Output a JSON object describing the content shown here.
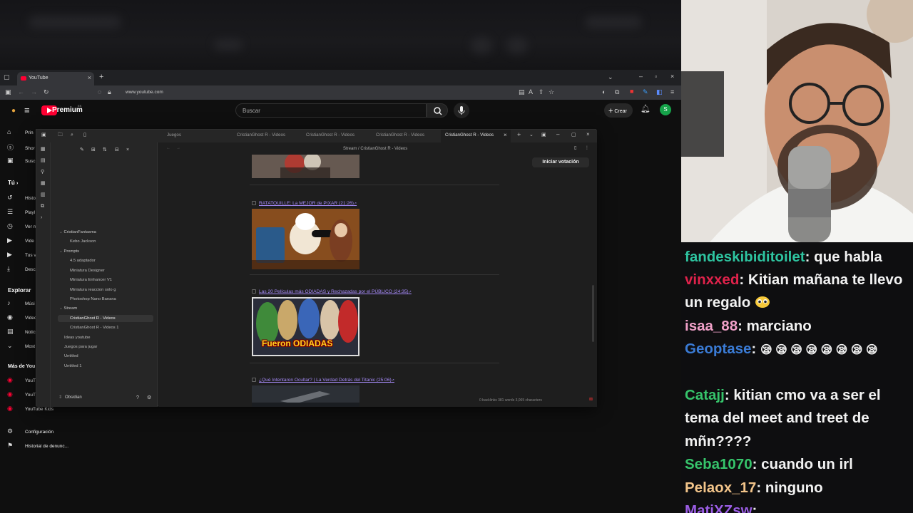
{
  "browser": {
    "tab_title": "YouTube",
    "url": "www.youtube.com"
  },
  "youtube": {
    "brand": "Premium",
    "brand_superscript": "ES",
    "search_placeholder": "Buscar",
    "create_label": "Crear",
    "avatar_letter": "S",
    "sidebar": {
      "items_top": [
        {
          "label": "Prin",
          "icon": "home-icon"
        },
        {
          "label": "Shor",
          "icon": "shorts-icon"
        },
        {
          "label": "Susc",
          "icon": "subscriptions-icon"
        }
      ],
      "you_header": "Tú",
      "items_you": [
        {
          "label": "Histo",
          "icon": "history-icon"
        },
        {
          "label": "Playl",
          "icon": "playlist-icon"
        },
        {
          "label": "Ver m",
          "icon": "watch-later-icon"
        },
        {
          "label": "Vide",
          "icon": "your-videos-icon"
        },
        {
          "label": "Tus v",
          "icon": "your-videos-icon"
        },
        {
          "label": "Desc",
          "icon": "download-icon"
        }
      ],
      "explore_header": "Explorar",
      "items_explore": [
        {
          "label": "Músi",
          "icon": "music-icon"
        },
        {
          "label": "Video",
          "icon": "gaming-icon"
        },
        {
          "label": "Notic",
          "icon": "news-icon"
        },
        {
          "label": "Most",
          "icon": "chevron-down-icon"
        }
      ],
      "more_header": "Más de You",
      "items_more": [
        {
          "label": "YouT",
          "icon": "youtube-studio-icon"
        },
        {
          "label": "YouT",
          "icon": "youtube-music-icon"
        },
        {
          "label": "YouTube Kids",
          "icon": "youtube-kids-icon"
        }
      ],
      "items_bottom": [
        {
          "label": "Configuración",
          "icon": "gear-icon"
        },
        {
          "label": "Historial de denunc...",
          "icon": "flag-icon"
        }
      ]
    }
  },
  "obsidian": {
    "tabs": [
      "Juegos",
      "CristianGhost R - Videos",
      "CristianGhost R - Videos",
      "CristianGhost R - Videos",
      "CristianGhost R - Videos"
    ],
    "breadcrumb": "Stream  /  CristianGhost R - Videos",
    "vote_button": "Iniciar votación",
    "tree": [
      {
        "label": "CristianFantasma",
        "type": "folder"
      },
      {
        "label": "Kebo Jackson",
        "type": "file"
      },
      {
        "label": "Prompts",
        "type": "folder"
      },
      {
        "label": "4.5 adaptador",
        "type": "file"
      },
      {
        "label": "Miniatura Designer",
        "type": "file"
      },
      {
        "label": "Miniatura Enhancer V1",
        "type": "file"
      },
      {
        "label": "Miniatura reaccion solo g",
        "type": "file"
      },
      {
        "label": "Photoshop Nano Banana",
        "type": "file"
      },
      {
        "label": "Stream",
        "type": "folder"
      },
      {
        "label": "CristianGhost R - Videos",
        "type": "file"
      },
      {
        "label": "CristianGhost R - Videos 1",
        "type": "file"
      },
      {
        "label": "Ideas youtube",
        "type": "root"
      },
      {
        "label": "Juegos para jugar",
        "type": "root"
      },
      {
        "label": "Untitled",
        "type": "root"
      },
      {
        "label": "Untitled 1",
        "type": "root"
      }
    ],
    "vault_name": "Obsidian",
    "videos": [
      {
        "title": "RATATOUILLE: La MEJOR de PIXAR (21:26)"
      },
      {
        "title": "Las 20 Películas más ODIADAS y Rechazadas por el PÚBLICO (24:35)",
        "thumb_text": "Fueron ODIADAS"
      },
      {
        "title": "¿Qué Intentaron Ocultar? | La Verdad Detrás del Titanic (25:06)"
      }
    ],
    "status": "0 backlinks   381 words  3,065 characters"
  },
  "chat": {
    "messages": [
      {
        "user": "fandeskibiditoilet",
        "text": "que habla",
        "color": "#2ec4a0"
      },
      {
        "user": "vinxxed",
        "text": "Kitian mañana te llevo un regalo",
        "color": "#e0224b",
        "emote": "pleading-emote"
      },
      {
        "user": "isaa_88",
        "text": "marciano",
        "color": "#f0a0c8"
      },
      {
        "user": "Geoptase",
        "text": "",
        "color": "#3a7bd5",
        "emote": "sleeping-emote-x8"
      },
      {
        "user": "Catajj",
        "text": "kitian cmo va a ser el tema del meet and treet de mñn????",
        "color": "#36c46b"
      },
      {
        "user": "Seba1070",
        "text": "cuando un irl",
        "color": "#36c46b"
      },
      {
        "user": "Pelaox_17",
        "text": "ninguno",
        "color": "#f2c48a"
      },
      {
        "user": "MatiXZsw",
        "text": "",
        "color": "#9b5de5"
      }
    ]
  }
}
